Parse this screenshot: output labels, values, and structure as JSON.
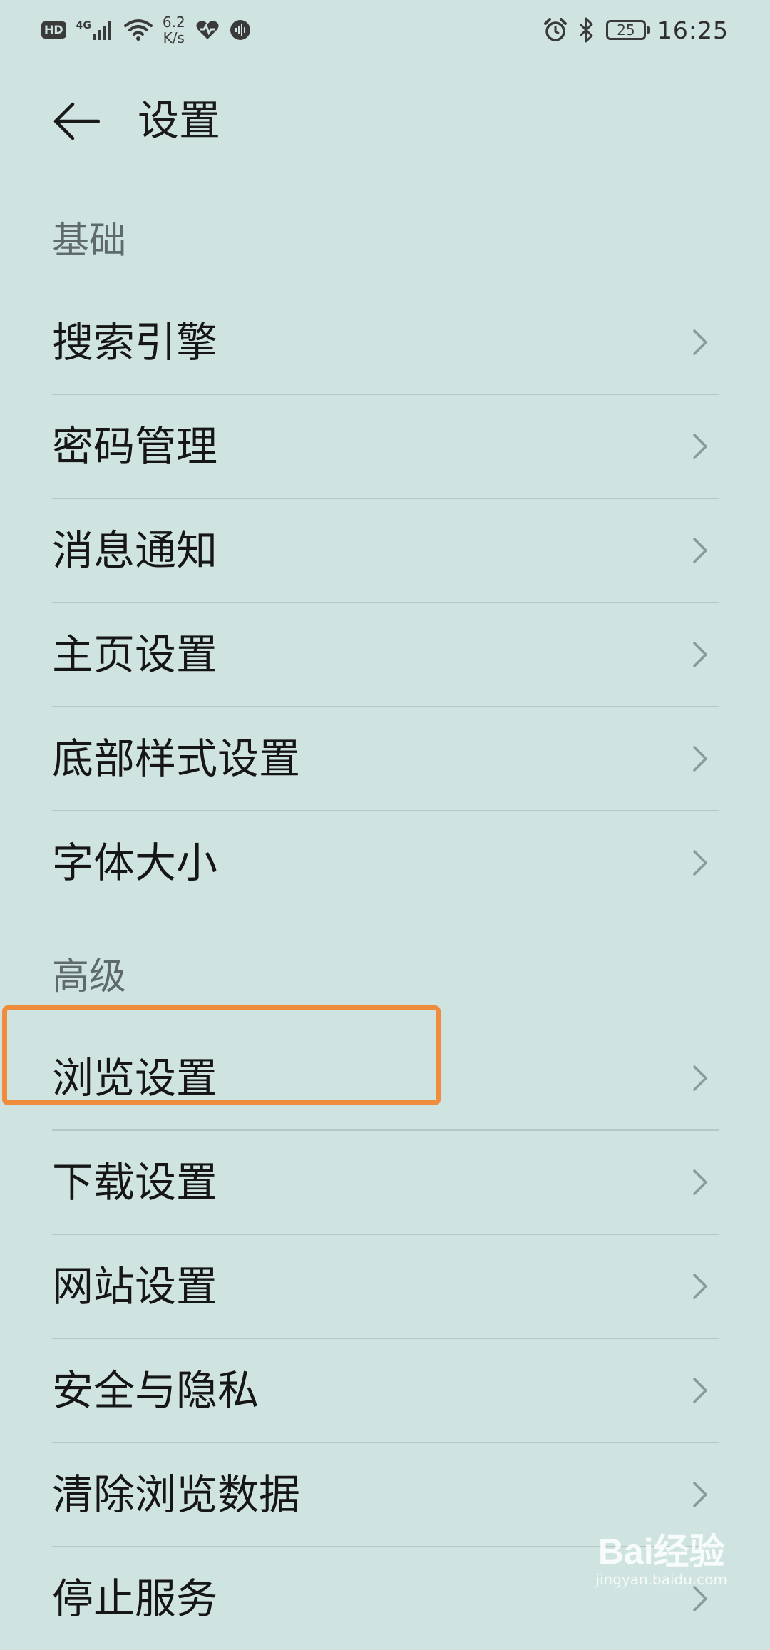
{
  "status_bar": {
    "hd": "HD",
    "network": "4G",
    "speed_value": "6.2",
    "speed_unit": "K/s",
    "battery": "25",
    "time": "16:25"
  },
  "header": {
    "title": "设置"
  },
  "sections": [
    {
      "title": "基础",
      "items": [
        {
          "label": "搜索引擎"
        },
        {
          "label": "密码管理"
        },
        {
          "label": "消息通知"
        },
        {
          "label": "主页设置"
        },
        {
          "label": "底部样式设置"
        },
        {
          "label": "字体大小"
        }
      ]
    },
    {
      "title": "高级",
      "items": [
        {
          "label": "浏览设置"
        },
        {
          "label": "下载设置"
        },
        {
          "label": "网站设置"
        },
        {
          "label": "安全与隐私"
        },
        {
          "label": "清除浏览数据"
        },
        {
          "label": "停止服务"
        }
      ]
    }
  ],
  "watermark": {
    "brand": "Bai经验",
    "url": "jingyan.baidu.com"
  },
  "colors": {
    "background": "#cfe3e1",
    "highlight": "#f08c3e",
    "divider": "#b6c8c6"
  }
}
